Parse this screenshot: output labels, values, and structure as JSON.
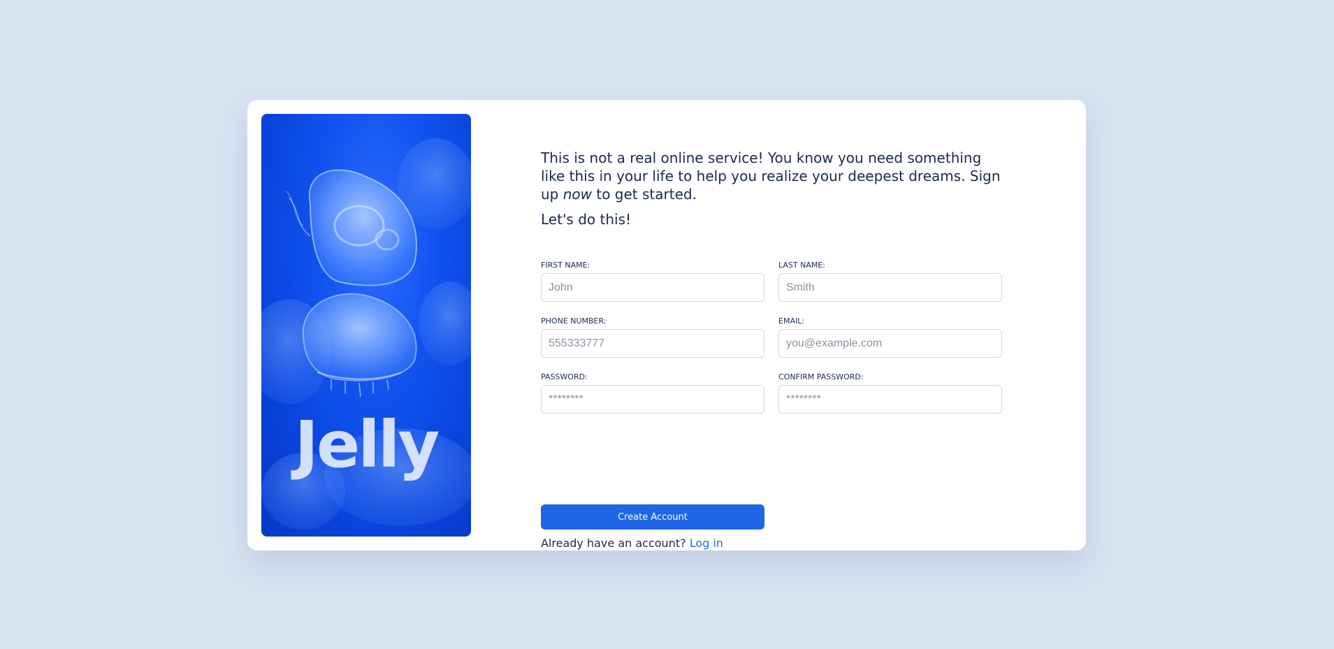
{
  "hero": {
    "brand": "Jelly"
  },
  "intro": {
    "text_before": "This is not a real online service! You know you need something like this in your life to help you realize your deepest dreams. Sign up ",
    "emphasis": "now",
    "text_after": " to get started.",
    "tagline": "Let's do this!"
  },
  "form": {
    "first_name": {
      "label": "FIRST NAME:",
      "placeholder": "John",
      "value": ""
    },
    "last_name": {
      "label": "LAST NAME:",
      "placeholder": "Smith",
      "value": ""
    },
    "phone": {
      "label": "PHONE NUMBER:",
      "placeholder": "555333777",
      "value": ""
    },
    "email": {
      "label": "EMAIL:",
      "placeholder": "you@example.com",
      "value": ""
    },
    "password": {
      "label": "PASSWORD:",
      "placeholder": "********",
      "value": ""
    },
    "confirm_password": {
      "label": "CONFIRM PASSWORD:",
      "placeholder": "********",
      "value": ""
    },
    "submit_label": "Create Account"
  },
  "login": {
    "prompt": "Already have an account?",
    "link_label": "Log in"
  },
  "colors": {
    "page_background": "#d6e2f0",
    "accent": "#1f67e6",
    "text": "#1b2a4a",
    "hero_blue": "#0a45df"
  },
  "icons": {
    "hero_illustration": "jellyfish-illustration"
  }
}
